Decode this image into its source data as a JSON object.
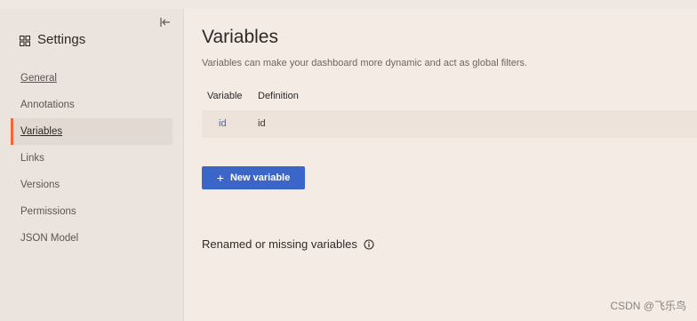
{
  "sidebar": {
    "title": "Settings",
    "title_icon": "grid-icon",
    "collapse_icon": "collapse-left-icon",
    "items": [
      {
        "label": "General"
      },
      {
        "label": "Annotations"
      },
      {
        "label": "Variables"
      },
      {
        "label": "Links"
      },
      {
        "label": "Versions"
      },
      {
        "label": "Permissions"
      },
      {
        "label": "JSON Model"
      }
    ],
    "active_item": "Variables"
  },
  "main": {
    "title": "Variables",
    "subtitle": "Variables can make your dashboard more dynamic and act as global filters.",
    "table": {
      "headers": [
        "Variable",
        "Definition"
      ],
      "rows": [
        {
          "variable": "id",
          "definition": "id"
        }
      ]
    },
    "new_variable_button": "New variable",
    "new_variable_icon": "plus-icon",
    "missing_section_title": "Renamed or missing variables",
    "missing_info_icon": "info-icon"
  },
  "watermark": "CSDN @飞乐鸟",
  "colors": {
    "accent": "#3b66c7",
    "active_indicator": "#f0693a",
    "background": "#f4ebe4",
    "sidebar_bg": "#ebe3dd"
  }
}
